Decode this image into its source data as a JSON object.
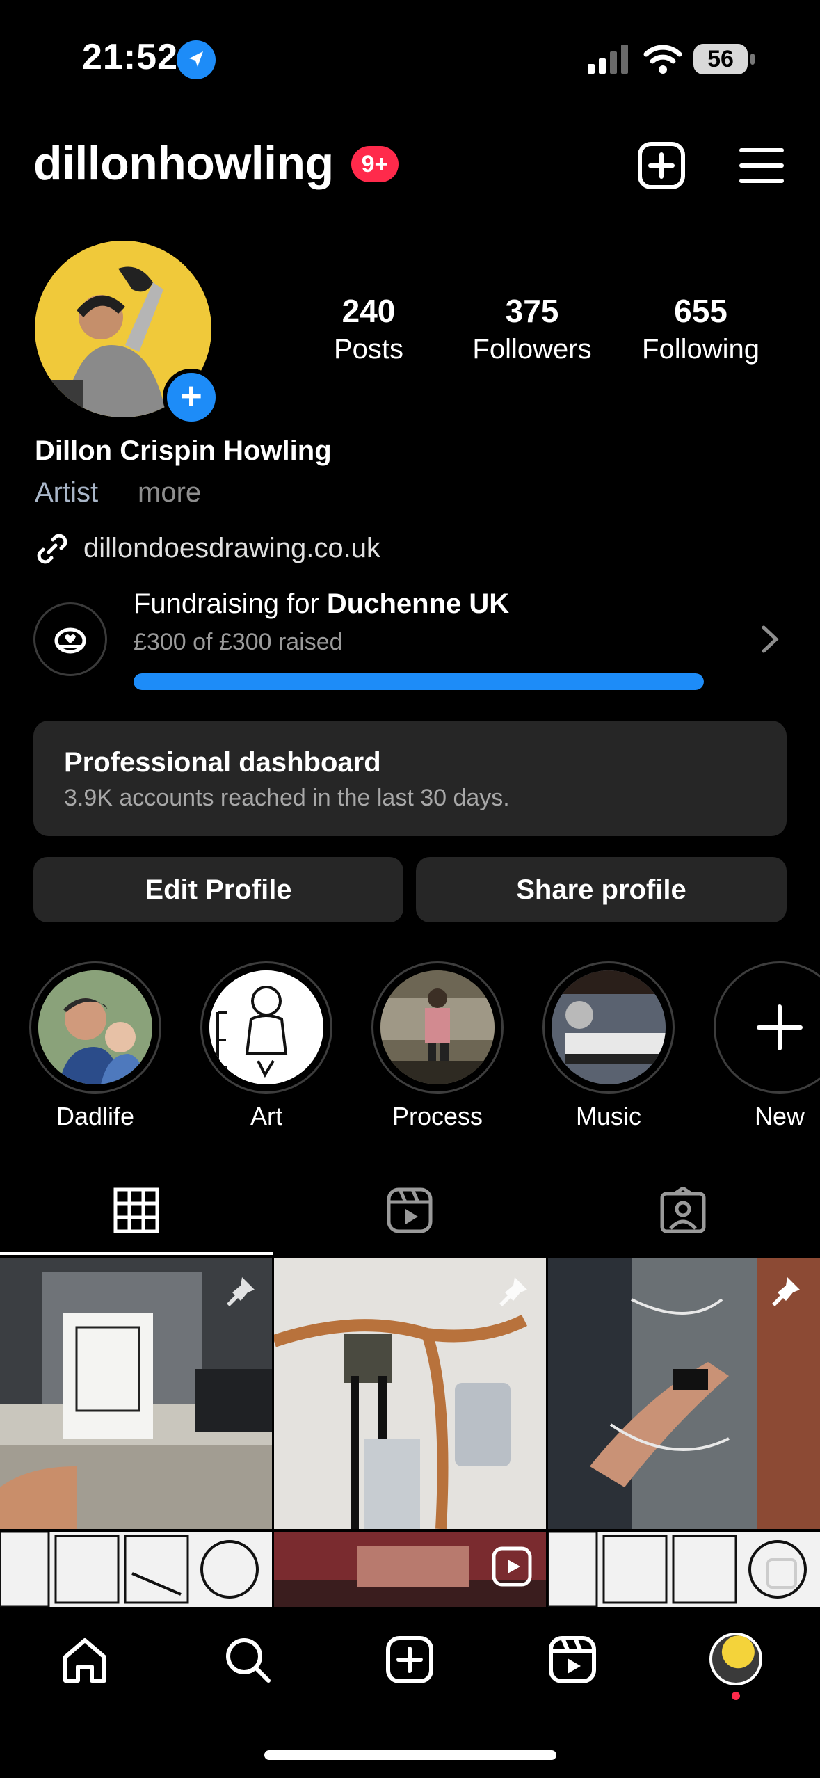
{
  "status_bar": {
    "time": "21:52",
    "battery": "56",
    "icons": [
      "location-arrow-icon",
      "cellular-signal-icon",
      "wifi-icon",
      "battery-icon"
    ]
  },
  "header": {
    "username": "dillonhowling",
    "notification_badge": "9+",
    "icons": [
      "new-post-icon",
      "menu-icon"
    ]
  },
  "profile": {
    "stats": [
      {
        "value": "240",
        "label": "Posts"
      },
      {
        "value": "375",
        "label": "Followers"
      },
      {
        "value": "655",
        "label": "Following"
      }
    ],
    "full_name": "Dillon Crispin Howling",
    "category": "Artist",
    "more_label": "more",
    "link": "dillondoesdrawing.co.uk"
  },
  "fundraiser": {
    "title_prefix": "Fundraising for",
    "charity": "Duchenne UK",
    "progress_text": "£300 of £300 raised",
    "progress_fraction": 1.0
  },
  "dashboard": {
    "title": "Professional dashboard",
    "subtitle": "3.9K accounts reached in the last 30 days."
  },
  "buttons": {
    "edit": "Edit Profile",
    "share": "Share profile"
  },
  "highlights": [
    {
      "label": "Dadlife"
    },
    {
      "label": "Art"
    },
    {
      "label": "Process"
    },
    {
      "label": "Music"
    },
    {
      "label": "New"
    }
  ],
  "tabs": [
    "grid-icon",
    "reels-icon",
    "tagged-icon"
  ],
  "bottom_nav": [
    "home-icon",
    "search-icon",
    "create-icon",
    "reels-icon",
    "profile-avatar"
  ],
  "colors": {
    "accent": "#1d8cf8",
    "badge": "#ff2a4b",
    "card": "#262626"
  }
}
